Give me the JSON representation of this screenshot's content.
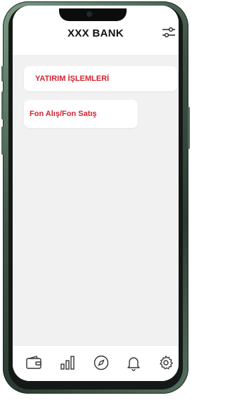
{
  "header": {
    "title": "XXX BANK",
    "filter_icon": "sliders-icon"
  },
  "menu": {
    "items": [
      {
        "label": "YATIRIM İŞLEMLERİ"
      },
      {
        "label": "Fon Alış/Fon Satış"
      }
    ]
  },
  "tabbar": {
    "items": [
      {
        "icon": "wallet-icon"
      },
      {
        "icon": "bar-chart-icon"
      },
      {
        "icon": "compass-icon"
      },
      {
        "icon": "bell-icon"
      },
      {
        "icon": "gear-icon"
      }
    ]
  },
  "colors": {
    "accent": "#d32330",
    "background": "#f1f1f1",
    "header_bg": "#ffffff"
  }
}
